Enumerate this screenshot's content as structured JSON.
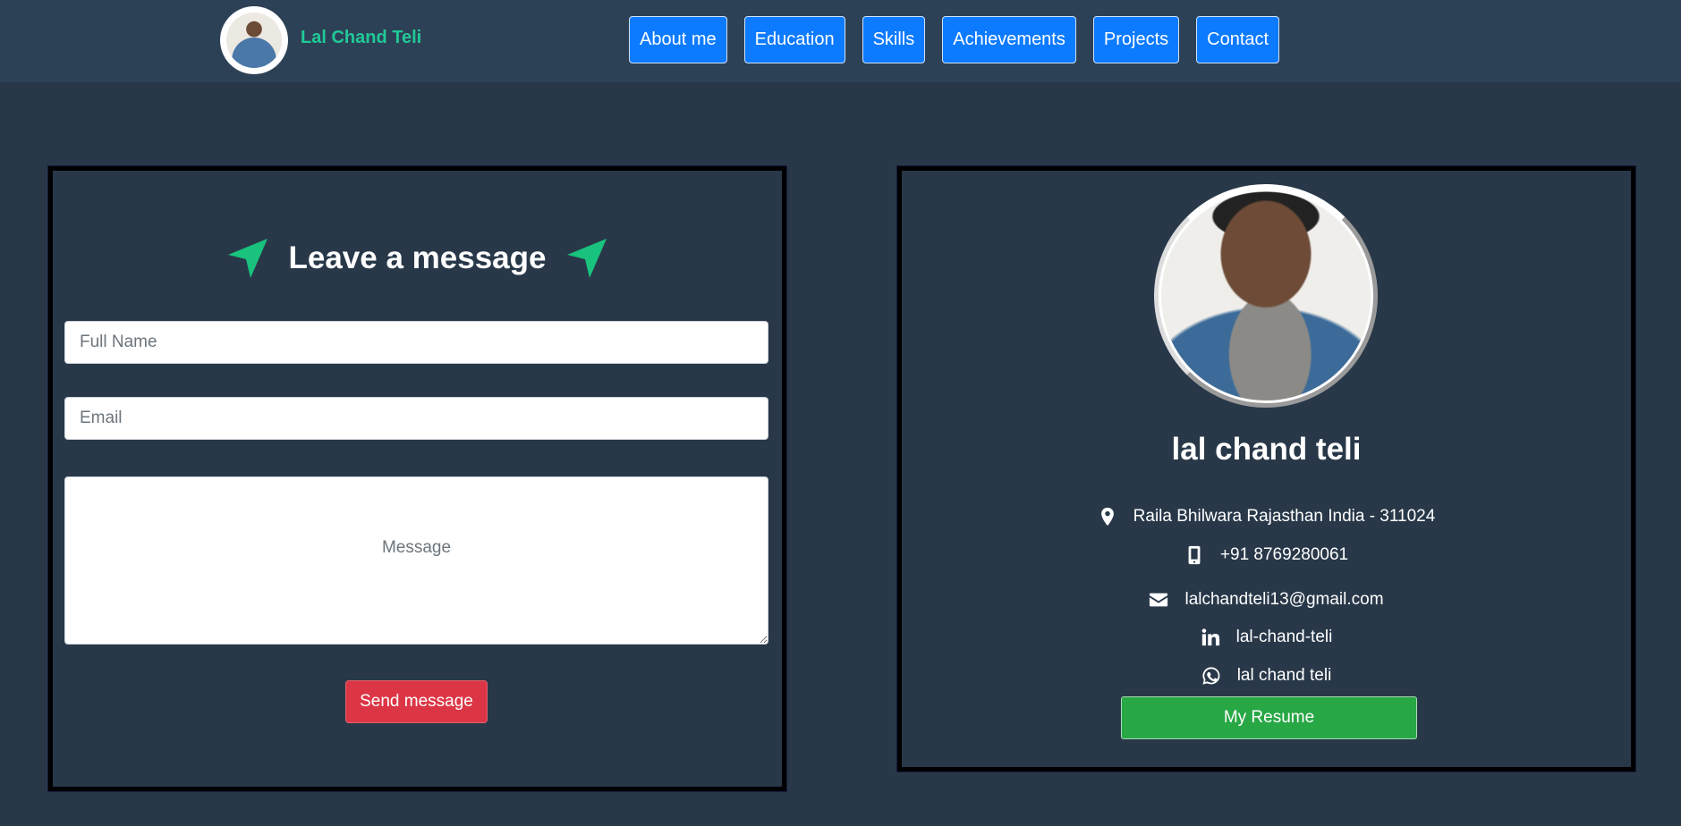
{
  "header": {
    "brand_name": "Lal Chand Teli",
    "nav": [
      {
        "label": "About me"
      },
      {
        "label": "Education"
      },
      {
        "label": "Skills"
      },
      {
        "label": "Achievements"
      },
      {
        "label": "Projects"
      },
      {
        "label": "Contact"
      }
    ]
  },
  "contact_form": {
    "title": "Leave a message",
    "title_icon": "location-arrow-icon",
    "name_placeholder": "Full Name",
    "email_placeholder": "Email",
    "message_placeholder": "Message",
    "submit_label": "Send message"
  },
  "profile": {
    "name": "lal chand teli",
    "address": "Raila Bhilwara Rajasthan India - 311024",
    "phone": "+91 8769280061",
    "email": "lalchandteli13@gmail.com",
    "linkedin": "lal-chand-teli",
    "whatsapp": "lal chand teli",
    "resume_label": "My Resume"
  },
  "colors": {
    "background": "#283849",
    "navbar": "#2d4156",
    "brand": "#20c997",
    "nav_button": "#0d7bff",
    "send_button": "#dc3545",
    "resume_button": "#28a745",
    "arrow_icon": "#19c37d"
  }
}
